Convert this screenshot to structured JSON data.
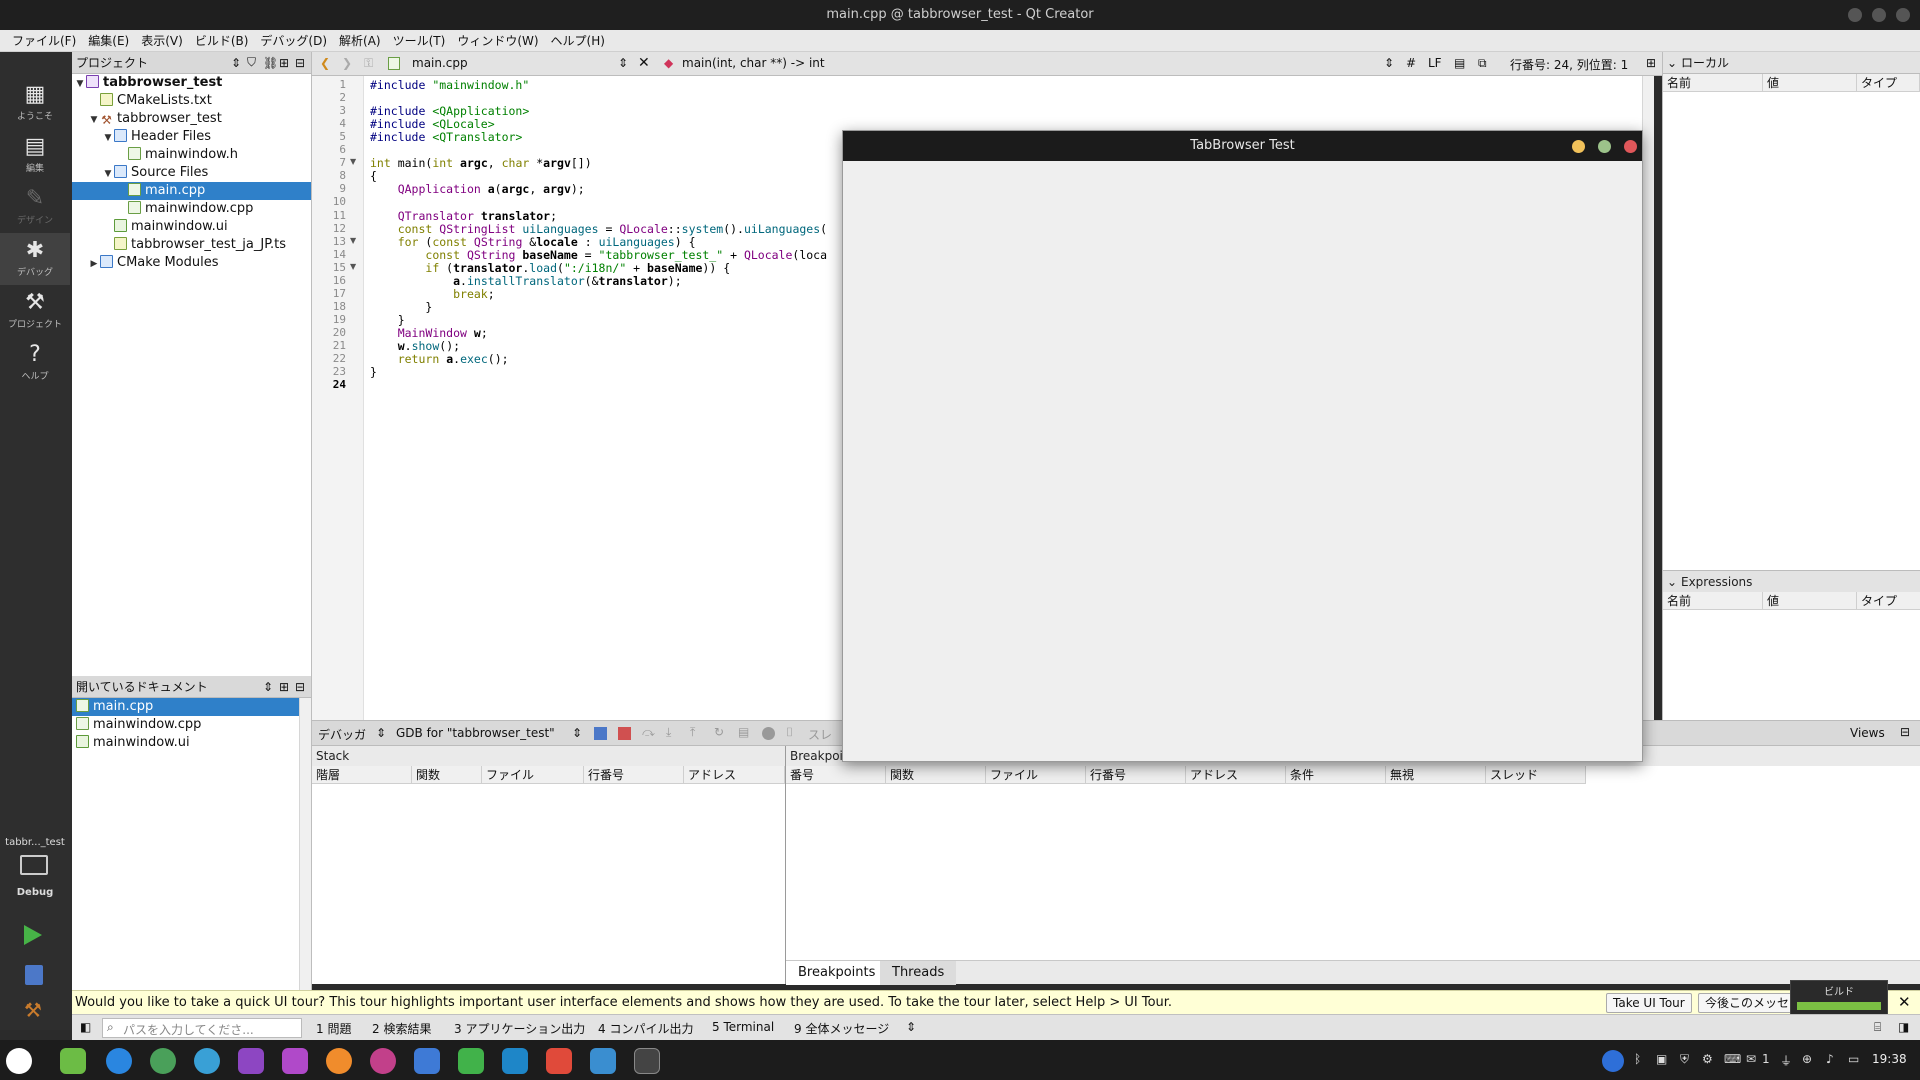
{
  "window_title": "main.cpp @ tabbrowser_test - Qt Creator",
  "menu": [
    "ファイル(F)",
    "編集(E)",
    "表示(V)",
    "ビルド(B)",
    "デバッグ(D)",
    "解析(A)",
    "ツール(T)",
    "ウィンドウ(W)",
    "ヘルプ(H)"
  ],
  "modes": [
    {
      "label": "ようこそ",
      "icon": "grid-icon"
    },
    {
      "label": "編集",
      "icon": "edit-doc-icon"
    },
    {
      "label": "デザイン",
      "icon": "pen-icon"
    },
    {
      "label": "デバッグ",
      "icon": "bug-icon"
    },
    {
      "label": "プロジェクト",
      "icon": "wrench-icon"
    },
    {
      "label": "ヘルプ",
      "icon": "help-icon"
    }
  ],
  "target": {
    "project": "tabbr..._test",
    "config": "Debug"
  },
  "project_panel": {
    "title": "プロジェクト",
    "tree": [
      {
        "label": "tabbrowser_test",
        "depth": 0,
        "twisty": "▼",
        "icon": "proj",
        "bold": true
      },
      {
        "label": "CMakeLists.txt",
        "depth": 1,
        "twisty": "",
        "icon": "txt"
      },
      {
        "label": "tabbrowser_test",
        "depth": 1,
        "twisty": "▼",
        "icon": "hammer"
      },
      {
        "label": "Header Files",
        "depth": 2,
        "twisty": "▼",
        "icon": "fold"
      },
      {
        "label": "mainwindow.h",
        "depth": 3,
        "twisty": "",
        "icon": "h"
      },
      {
        "label": "Source Files",
        "depth": 2,
        "twisty": "▼",
        "icon": "fold"
      },
      {
        "label": "main.cpp",
        "depth": 3,
        "twisty": "",
        "icon": "cpp",
        "selected": true
      },
      {
        "label": "mainwindow.cpp",
        "depth": 3,
        "twisty": "",
        "icon": "cpp"
      },
      {
        "label": "mainwindow.ui",
        "depth": 2,
        "twisty": "",
        "icon": "ui"
      },
      {
        "label": "tabbrowser_test_ja_JP.ts",
        "depth": 2,
        "twisty": "",
        "icon": "txt"
      },
      {
        "label": "CMake Modules",
        "depth": 1,
        "twisty": "▶",
        "icon": "fold"
      }
    ]
  },
  "open_docs": {
    "title": "開いているドキュメント",
    "items": [
      {
        "label": "main.cpp",
        "icon": "cpp",
        "selected": true
      },
      {
        "label": "mainwindow.cpp",
        "icon": "cpp"
      },
      {
        "label": "mainwindow.ui",
        "icon": "ui"
      }
    ]
  },
  "editor_toolbar": {
    "file": "main.cpp",
    "symbol": "main(int, char **) -> int",
    "hash": "#",
    "eol": "LF",
    "position": "行番号: 24, 列位置: 1"
  },
  "code_lines": [
    "#include \"mainwindow.h\"",
    "",
    "#include <QApplication>",
    "#include <QLocale>",
    "#include <QTranslator>",
    "",
    "int main(int argc, char *argv[])",
    "{",
    "    QApplication a(argc, argv);",
    "",
    "    QTranslator translator;",
    "    const QStringList uiLanguages = QLocale::system().uiLanguages(",
    "    for (const QString &locale : uiLanguages) {",
    "        const QString baseName = \"tabbrowser_test_\" + QLocale(loca",
    "        if (translator.load(\":/i18n/\" + baseName)) {",
    "            a.installTranslator(&translator);",
    "            break;",
    "        }",
    "    }",
    "    MainWindow w;",
    "    w.show();",
    "    return a.exec();",
    "}",
    ""
  ],
  "locals": {
    "title": "ローカル",
    "cols": [
      "名前",
      "値",
      "タイプ"
    ]
  },
  "expressions": {
    "title": "Expressions",
    "cols": [
      "名前",
      "値",
      "タイプ"
    ]
  },
  "debug_bar": {
    "mode": "デバッガ",
    "engine": "GDB for \"tabbrowser_test\"",
    "thread_label": "スレ",
    "views": "Views"
  },
  "stack": {
    "title": "Stack",
    "cols": [
      "階層",
      "関数",
      "ファイル",
      "行番号",
      "アドレス"
    ]
  },
  "breakpoints": {
    "title": "Breakpoints",
    "cols": [
      "番号",
      "関数",
      "ファイル",
      "行番号",
      "アドレス",
      "条件",
      "無視",
      "スレッド"
    ]
  },
  "bp_tabs": [
    "Breakpoints",
    "Threads"
  ],
  "tour": {
    "text": "Would you like to take a quick UI tour? This tour highlights important user interface elements and shows how they are used. To take the tour later, select Help > UI Tour.",
    "take_btn": "Take UI Tour",
    "dismiss_btn": "今後このメッセ..."
  },
  "status": {
    "search_placeholder": "パスを入力してくださ...",
    "tabs": [
      "1 問題",
      "2 検索結果",
      "3 アプリケーション出力",
      "4 コンパイル出力",
      "5 Terminal",
      "9 全体メッセージ"
    ],
    "build_label": "ビルド",
    "build_progress": 1.0
  },
  "app_window": {
    "title": "TabBrowser Test"
  },
  "clock": "19:38",
  "tray_text": "1",
  "colors": {
    "selection": "#2f80c9",
    "accent_build": "#7bc043"
  }
}
